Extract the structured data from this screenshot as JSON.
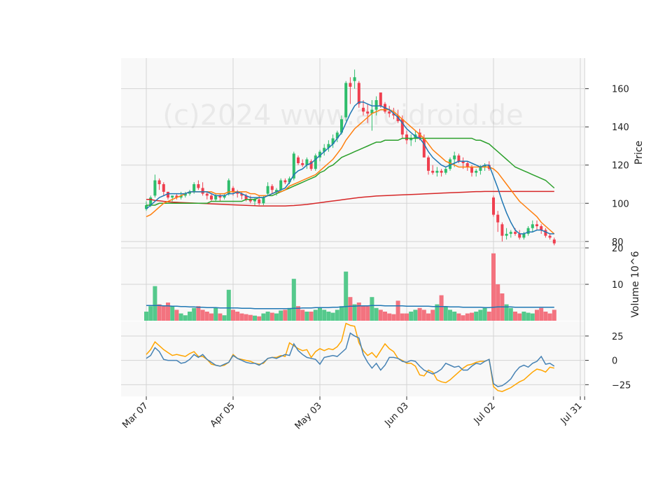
{
  "watermark": "(c)2024 www.aroidroid.de",
  "chart_data": {
    "type": "candlestick",
    "x_tick_labels": [
      "Mar 07",
      "Apr 05",
      "May 03",
      "Jun 03",
      "Jul 02",
      "Jul 31"
    ],
    "x_tick_index": [
      0,
      20,
      40,
      60,
      80,
      100
    ],
    "colors": {
      "up": "#2ebd6b",
      "down": "#ef3f4f",
      "ma_short": "#1f77b4",
      "ma_mid": "#ff7f0e",
      "ma_long": "#2ca02c",
      "ma_xlong": "#d62728",
      "osc1": "#4682b4",
      "osc2": "#ffa500"
    },
    "price_panel": {
      "ylabel": "Price",
      "ylim": [
        77,
        176
      ],
      "yticks": [
        80,
        100,
        120,
        140,
        160
      ],
      "ohlc": [
        [
          97,
          101,
          96,
          99
        ],
        [
          99,
          104,
          98,
          103
        ],
        [
          104,
          115,
          103,
          112
        ],
        [
          112,
          113,
          107,
          110
        ],
        [
          110,
          111,
          104,
          106
        ],
        [
          106,
          106,
          102,
          103
        ],
        [
          103,
          104,
          101,
          104
        ],
        [
          104,
          105,
          102,
          103
        ],
        [
          103,
          106,
          102,
          104
        ],
        [
          104,
          106,
          103,
          105
        ],
        [
          105,
          107,
          104,
          106
        ],
        [
          106,
          111,
          105,
          110
        ],
        [
          110,
          112,
          107,
          108
        ],
        [
          108,
          111,
          104,
          105
        ],
        [
          105,
          106,
          102,
          104
        ],
        [
          104,
          105,
          101,
          102
        ],
        [
          102,
          105,
          101,
          104
        ],
        [
          104,
          105,
          101,
          103
        ],
        [
          103,
          105,
          102,
          104
        ],
        [
          105,
          113,
          104,
          112
        ],
        [
          108,
          109,
          104,
          106
        ],
        [
          106,
          107,
          103,
          105
        ],
        [
          105,
          106,
          102,
          104
        ],
        [
          104,
          105,
          101,
          102
        ],
        [
          102,
          104,
          100,
          101
        ],
        [
          101,
          103,
          99,
          102
        ],
        [
          102,
          104,
          99,
          100
        ],
        [
          100,
          104,
          99,
          103
        ],
        [
          105,
          111,
          104,
          109
        ],
        [
          109,
          110,
          105,
          107
        ],
        [
          106,
          108,
          104,
          107
        ],
        [
          107,
          113,
          106,
          112
        ],
        [
          112,
          113,
          110,
          111
        ],
        [
          111,
          114,
          110,
          113
        ],
        [
          113,
          127,
          112,
          126
        ],
        [
          124,
          125,
          120,
          121
        ],
        [
          121,
          123,
          119,
          120
        ],
        [
          120,
          124,
          118,
          123
        ],
        [
          122,
          123,
          117,
          118
        ],
        [
          118,
          126,
          117,
          125
        ],
        [
          124,
          128,
          122,
          127
        ],
        [
          127,
          131,
          125,
          129
        ],
        [
          129,
          133,
          127,
          131
        ],
        [
          131,
          136,
          129,
          134
        ],
        [
          134,
          138,
          132,
          137
        ],
        [
          137,
          146,
          136,
          144
        ],
        [
          145,
          164,
          143,
          163
        ],
        [
          163,
          166,
          152,
          161
        ],
        [
          164,
          170,
          160,
          166
        ],
        [
          163,
          164,
          150,
          152
        ],
        [
          150,
          154,
          146,
          148
        ],
        [
          148,
          152,
          142,
          147
        ],
        [
          147,
          154,
          138,
          149
        ],
        [
          149,
          156,
          146,
          154
        ],
        [
          158,
          155,
          150,
          151
        ],
        [
          152,
          153,
          147,
          148
        ],
        [
          148,
          151,
          145,
          147
        ],
        [
          147,
          150,
          144,
          146
        ],
        [
          146,
          149,
          142,
          143
        ],
        [
          144,
          146,
          134,
          136
        ],
        [
          136,
          138,
          131,
          133
        ],
        [
          133,
          136,
          130,
          134
        ],
        [
          134,
          138,
          132,
          136
        ],
        [
          137,
          139,
          133,
          134
        ],
        [
          134,
          136,
          124,
          124
        ],
        [
          124,
          125,
          115,
          117
        ],
        [
          117,
          120,
          115,
          116
        ],
        [
          116,
          119,
          114,
          117
        ],
        [
          117,
          118,
          114,
          116
        ],
        [
          116,
          119,
          115,
          118
        ],
        [
          118,
          124,
          117,
          123
        ],
        [
          123,
          127,
          119,
          125
        ],
        [
          125,
          126,
          121,
          122
        ],
        [
          122,
          124,
          118,
          121
        ],
        [
          121,
          122,
          117,
          119
        ],
        [
          119,
          120,
          114,
          116
        ],
        [
          116,
          118,
          114,
          117
        ],
        [
          117,
          120,
          115,
          119
        ],
        [
          119,
          121,
          117,
          120
        ],
        [
          120,
          122,
          117,
          118
        ],
        [
          103,
          104,
          93,
          94
        ],
        [
          94,
          96,
          85,
          90
        ],
        [
          89,
          90,
          80,
          83
        ],
        [
          83,
          87,
          81,
          84
        ],
        [
          84,
          86,
          82,
          85
        ],
        [
          85,
          87,
          83,
          84
        ],
        [
          84,
          86,
          81,
          82
        ],
        [
          82,
          85,
          81,
          84
        ],
        [
          84,
          88,
          83,
          87
        ],
        [
          87,
          91,
          85,
          89
        ],
        [
          89,
          91,
          86,
          88
        ],
        [
          88,
          89,
          84,
          86
        ],
        [
          86,
          87,
          82,
          83
        ],
        [
          83,
          84,
          81,
          82
        ],
        [
          81,
          82,
          78,
          79
        ]
      ],
      "ma_short": [
        97,
        99,
        101,
        103,
        104,
        105,
        105,
        105,
        105,
        105,
        106,
        106,
        106,
        106,
        106,
        105,
        104,
        104,
        104,
        105,
        105,
        106,
        105,
        104,
        103,
        103,
        103,
        103,
        104,
        105,
        106,
        107,
        108,
        111,
        115,
        117,
        118,
        120,
        121,
        123,
        125,
        127,
        129,
        131,
        134,
        137,
        142,
        147,
        151,
        153,
        153,
        152,
        151,
        151,
        151,
        150,
        149,
        147,
        145,
        142,
        139,
        137,
        135,
        134,
        131,
        127,
        124,
        122,
        120,
        119,
        120,
        121,
        122,
        122,
        122,
        121,
        120,
        119,
        120,
        120,
        114,
        108,
        101,
        95,
        90,
        86,
        84,
        84,
        85,
        85,
        86,
        86,
        85,
        84,
        84
      ],
      "ma_mid": [
        93,
        94,
        96,
        98,
        100,
        101,
        102,
        103,
        104,
        105,
        106,
        106,
        106,
        106,
        106,
        106,
        105,
        105,
        105,
        106,
        106,
        106,
        106,
        106,
        105,
        105,
        104,
        104,
        104,
        105,
        106,
        106,
        107,
        109,
        110,
        111,
        112,
        113,
        114,
        115,
        117,
        119,
        121,
        123,
        126,
        129,
        133,
        136,
        139,
        141,
        143,
        145,
        147,
        148,
        149,
        149,
        149,
        148,
        146,
        144,
        142,
        140,
        138,
        136,
        134,
        131,
        128,
        126,
        124,
        122,
        121,
        120,
        119,
        119,
        119,
        119,
        119,
        119,
        119,
        119,
        118,
        116,
        113,
        110,
        107,
        104,
        101,
        99,
        97,
        95,
        93,
        90,
        88,
        86,
        84
      ],
      "ma_long": [
        99,
        99,
        99,
        100,
        100,
        100,
        100,
        100,
        100,
        100,
        100,
        100,
        100,
        100,
        100,
        101,
        101,
        101,
        101,
        101,
        101,
        101,
        101,
        102,
        102,
        102,
        103,
        103,
        104,
        104,
        105,
        106,
        107,
        108,
        109,
        110,
        111,
        112,
        113,
        114,
        116,
        117,
        119,
        120,
        122,
        124,
        125,
        126,
        127,
        128,
        129,
        130,
        131,
        132,
        132,
        133,
        133,
        133,
        133,
        134,
        134,
        134,
        134,
        134,
        134,
        134,
        134,
        134,
        134,
        134,
        134,
        134,
        134,
        134,
        134,
        134,
        133,
        133,
        132,
        131,
        129,
        127,
        125,
        123,
        121,
        119,
        118,
        117,
        116,
        115,
        114,
        113,
        112,
        110,
        108
      ],
      "ma_xlong": [
        102,
        102,
        101.5,
        101.3,
        101,
        100.8,
        100.6,
        100.5,
        100.4,
        100.3,
        100.2,
        100.1,
        100,
        99.9,
        99.8,
        99.7,
        99.6,
        99.5,
        99.4,
        99.3,
        99.2,
        99.1,
        99,
        98.9,
        98.8,
        98.7,
        98.6,
        98.6,
        98.6,
        98.6,
        98.6,
        98.6,
        98.6,
        98.7,
        98.8,
        99,
        99.2,
        99.4,
        99.7,
        100,
        100.3,
        100.6,
        100.9,
        101.2,
        101.5,
        101.8,
        102.1,
        102.4,
        102.7,
        103,
        103.2,
        103.4,
        103.6,
        103.8,
        103.9,
        104,
        104.1,
        104.2,
        104.3,
        104.4,
        104.5,
        104.6,
        104.7,
        104.8,
        104.9,
        105,
        105.1,
        105.2,
        105.3,
        105.4,
        105.5,
        105.6,
        105.7,
        105.8,
        105.9,
        106,
        106.1,
        106.1,
        106.2,
        106.2,
        106.2,
        106.2,
        106.2,
        106.2,
        106.2,
        106.2,
        106.2,
        106.2,
        106.2,
        106.2,
        106.2,
        106.2,
        106.2,
        106.2,
        106.2
      ]
    },
    "volume_panel": {
      "ylabel": "Volume  10^6",
      "ylim": [
        0,
        20
      ],
      "yticks": [
        10,
        20
      ],
      "values": [
        2.5,
        4,
        9.5,
        4.5,
        4,
        5,
        4,
        3,
        2,
        1.5,
        2.5,
        3.5,
        4,
        3,
        2.5,
        2,
        3.5,
        2,
        1.5,
        8.5,
        3,
        2.5,
        2,
        1.8,
        1.6,
        1.4,
        1.2,
        2,
        2.5,
        2.2,
        2,
        2.8,
        3,
        3.5,
        11.5,
        4,
        3,
        2.5,
        2.5,
        3,
        3.5,
        3,
        2.5,
        2.2,
        3,
        4,
        13.5,
        6.5,
        4.5,
        5,
        4,
        4,
        6.5,
        3.5,
        3,
        2.5,
        2,
        1.8,
        5.5,
        2,
        2,
        2.5,
        3,
        3.5,
        3,
        2,
        3,
        4.5,
        7,
        4,
        3,
        2.5,
        2,
        1.5,
        2,
        2.2,
        2.5,
        3,
        3.5,
        2.5,
        18.5,
        10,
        7.5,
        4.5,
        3.5,
        2.5,
        2,
        2.5,
        2.2,
        2,
        3,
        3.5,
        2.5,
        2,
        3
      ],
      "avg": [
        4.2,
        4.2,
        4.2,
        4.2,
        4.1,
        4.1,
        4,
        4,
        3.9,
        3.9,
        3.8,
        3.8,
        3.7,
        3.7,
        3.6,
        3.6,
        3.6,
        3.5,
        3.5,
        3.5,
        3.5,
        3.5,
        3.4,
        3.4,
        3.4,
        3.3,
        3.3,
        3.3,
        3.3,
        3.3,
        3.3,
        3.3,
        3.3,
        3.3,
        3.4,
        3.4,
        3.5,
        3.5,
        3.5,
        3.6,
        3.6,
        3.6,
        3.6,
        3.7,
        3.7,
        3.8,
        3.9,
        4,
        4,
        4.1,
        4.1,
        4.1,
        4.2,
        4.2,
        4.2,
        4.1,
        4.1,
        4.1,
        4.1,
        4.1,
        4,
        4,
        4,
        4,
        4,
        4,
        3.9,
        3.9,
        3.9,
        3.9,
        3.8,
        3.8,
        3.8,
        3.7,
        3.7,
        3.7,
        3.7,
        3.7,
        3.6,
        3.6,
        3.7,
        3.8,
        3.8,
        3.8,
        3.8,
        3.7,
        3.7,
        3.7,
        3.7,
        3.7,
        3.7,
        3.7,
        3.7,
        3.7,
        3.7
      ]
    },
    "oscillator_panel": {
      "ylim": [
        -37,
        40
      ],
      "yticks": [
        25,
        0,
        -25
      ],
      "tick_labels": [
        "25",
        "0",
        "−25"
      ],
      "series1": [
        2,
        5,
        13,
        9,
        1,
        0,
        0,
        0,
        -3,
        -2,
        1,
        6,
        3,
        6,
        1,
        -2,
        -5,
        -6,
        -4,
        -2,
        5,
        2,
        0,
        -2,
        -3,
        -3,
        -5,
        -2,
        2,
        3,
        2,
        4,
        6,
        5,
        17,
        10,
        6,
        3,
        2,
        1,
        -4,
        3,
        4,
        5,
        4,
        8,
        12,
        28,
        25,
        23,
        6,
        -2,
        -8,
        -3,
        -10,
        -5,
        3,
        3,
        2,
        -1,
        -2,
        0,
        -1,
        -6,
        -10,
        -12,
        -14,
        -12,
        -9,
        -3,
        -5,
        -7,
        -6,
        -10,
        -10,
        -6,
        -3,
        -4,
        -1,
        1,
        -24,
        -27,
        -26,
        -23,
        -19,
        -12,
        -7,
        -5,
        -7,
        -3,
        -1,
        4,
        -4,
        -3,
        -6
      ],
      "series2": [
        6,
        11,
        19,
        15,
        11,
        8,
        5,
        6,
        5,
        4,
        7,
        9,
        4,
        4,
        1,
        -4,
        -5,
        -6,
        -5,
        -2,
        6,
        2,
        1,
        0,
        -1,
        -3,
        -4,
        -3,
        2,
        3,
        3,
        5,
        4,
        18,
        15,
        12,
        10,
        11,
        3,
        9,
        12,
        10,
        12,
        11,
        14,
        20,
        38,
        36,
        35,
        18,
        10,
        5,
        8,
        3,
        10,
        17,
        12,
        9,
        2,
        0,
        -3,
        -3,
        -6,
        -15,
        -16,
        -10,
        -12,
        -20,
        -22,
        -23,
        -20,
        -16,
        -12,
        -8,
        -5,
        -4,
        -2,
        -1,
        -1,
        1,
        -27,
        -31,
        -32,
        -30,
        -28,
        -25,
        -22,
        -20,
        -16,
        -12,
        -9,
        -10,
        -12,
        -7,
        -8
      ]
    }
  }
}
